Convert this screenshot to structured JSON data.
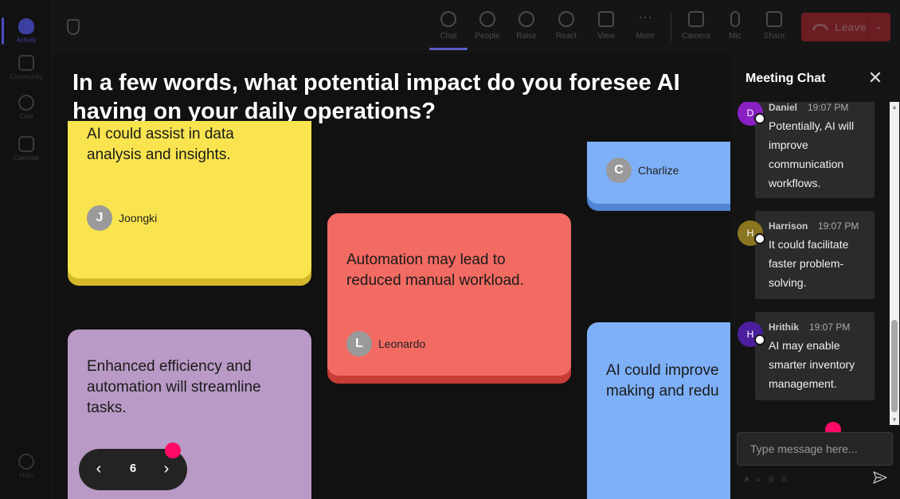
{
  "rail": {
    "items": [
      {
        "label": "Activity",
        "icon": "bell-icon"
      },
      {
        "label": "Community",
        "icon": "community-icon"
      },
      {
        "label": "Chat",
        "icon": "chat-icon"
      },
      {
        "label": "Calendar",
        "icon": "calendar-icon"
      }
    ],
    "help": "Help"
  },
  "toolbar": {
    "chat": "Chat",
    "people": "People",
    "raise": "Raise",
    "react": "React",
    "view": "View",
    "more": "More",
    "camera": "Camera",
    "mic": "Mic",
    "share": "Share",
    "leave": "Leave"
  },
  "stage": {
    "question": "In a few words, what potential impact do you foresee AI having on your daily operations?",
    "notes": [
      {
        "text": "AI could assist in data analysis and insights.",
        "author": "Joongki",
        "initial": "J"
      },
      {
        "text": "Automation may lead to reduced manual workload.",
        "author": "Leonardo",
        "initial": "L"
      },
      {
        "text": "",
        "author": "Charlize",
        "initial": "C"
      },
      {
        "text": "Enhanced efficiency and automation will streamline tasks.",
        "author": "",
        "initial": ""
      },
      {
        "text": "AI could improve making and redu",
        "author": "",
        "initial": ""
      }
    ],
    "pager": {
      "page": "6",
      "prev": "‹",
      "next": "›"
    }
  },
  "chat": {
    "title": "Meeting Chat",
    "close": "✕",
    "messages": [
      {
        "name": "Daniel",
        "time": "19:07 PM",
        "initial": "D",
        "color": "#8a1fc4",
        "body": "Potentially, AI will improve communication workflows."
      },
      {
        "name": "Harrison",
        "time": "19:07 PM",
        "initial": "H",
        "color": "#8a7520",
        "body": "It could facilitate faster problem-solving."
      },
      {
        "name": "Hrithik",
        "time": "19:07 PM",
        "initial": "H",
        "color": "#4a1e9e",
        "body": "AI may enable smarter inventory management."
      }
    ],
    "input_placeholder": "Type message here...",
    "format_icons": "A ☺ ⓖ ☷"
  },
  "colors": {
    "accent": "#5a5fc8",
    "leave": "#6b1d22",
    "cursor_dot": "#ff0a66"
  }
}
